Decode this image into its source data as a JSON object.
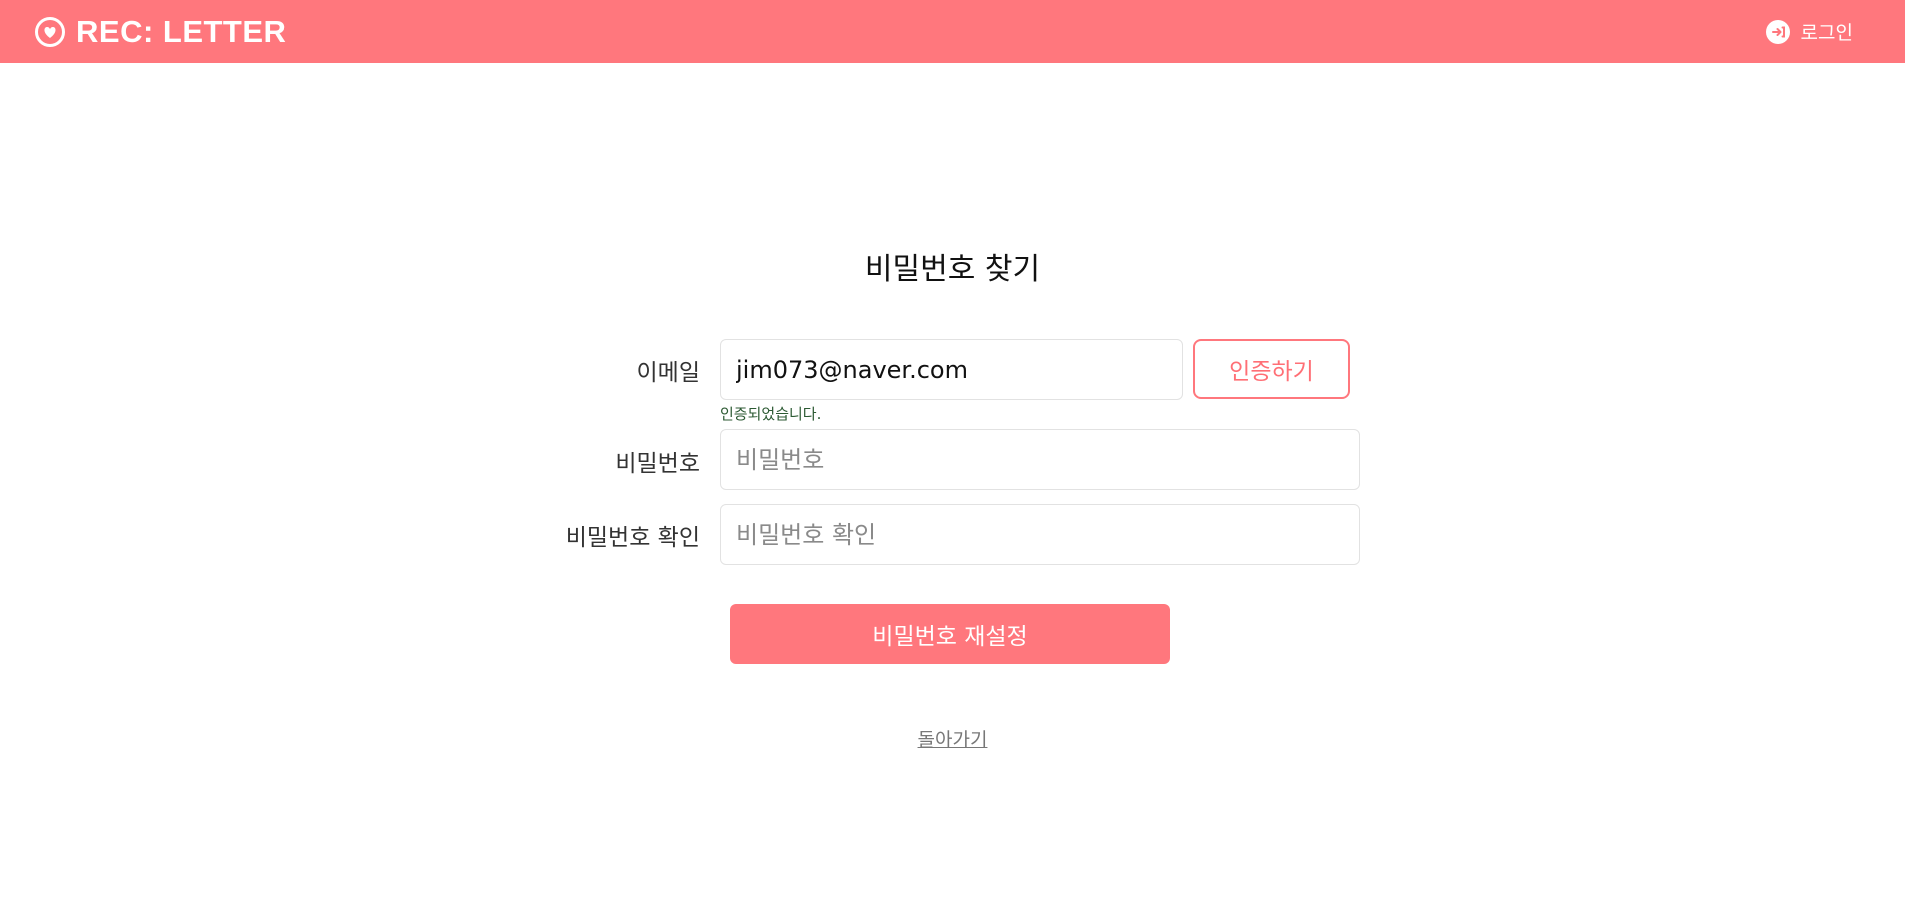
{
  "header": {
    "logo_text": "REC: LETTER",
    "logo_icon": "heart-circle-icon",
    "login_label": "로그인",
    "login_icon": "login-icon",
    "accent_color": "#ff777d"
  },
  "page": {
    "title": "비밀번호 찾기"
  },
  "form": {
    "email": {
      "label": "이메일",
      "value": "jim073@naver.com",
      "verify_button": "인증하기",
      "status_message": "인증되었습니다."
    },
    "password": {
      "label": "비밀번호",
      "placeholder": "비밀번호"
    },
    "password_confirm": {
      "label": "비밀번호 확인",
      "placeholder": "비밀번호 확인"
    },
    "submit_label": "비밀번호 재설정",
    "back_label": "돌아가기"
  }
}
